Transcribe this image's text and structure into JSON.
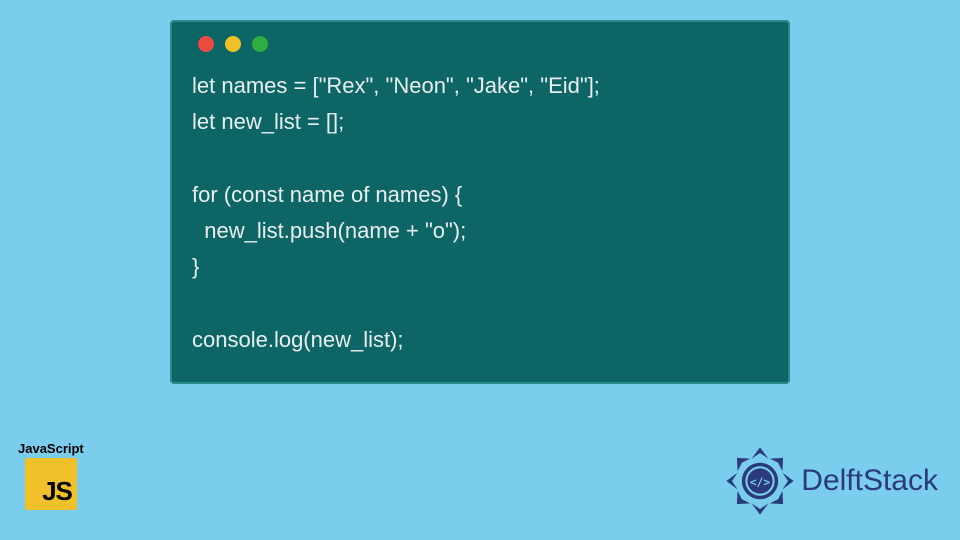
{
  "code_block": {
    "lines": [
      "let names = [\"Rex\", \"Neon\", \"Jake\", \"Eid\"];",
      "let new_list = [];",
      "",
      "for (const name of names) {",
      "  new_list.push(name + \"o\");",
      "}",
      "",
      "console.log(new_list);"
    ],
    "window_dots": [
      "red",
      "yellow",
      "green"
    ],
    "bg_color": "#0e6565",
    "text_color": "#e8eff0"
  },
  "js_badge": {
    "label": "JavaScript",
    "short": "JS",
    "bg_color": "#f2c029"
  },
  "brand": {
    "name": "DelftStack",
    "color": "#2a3a7a"
  },
  "page_bg": "#7bcdee"
}
